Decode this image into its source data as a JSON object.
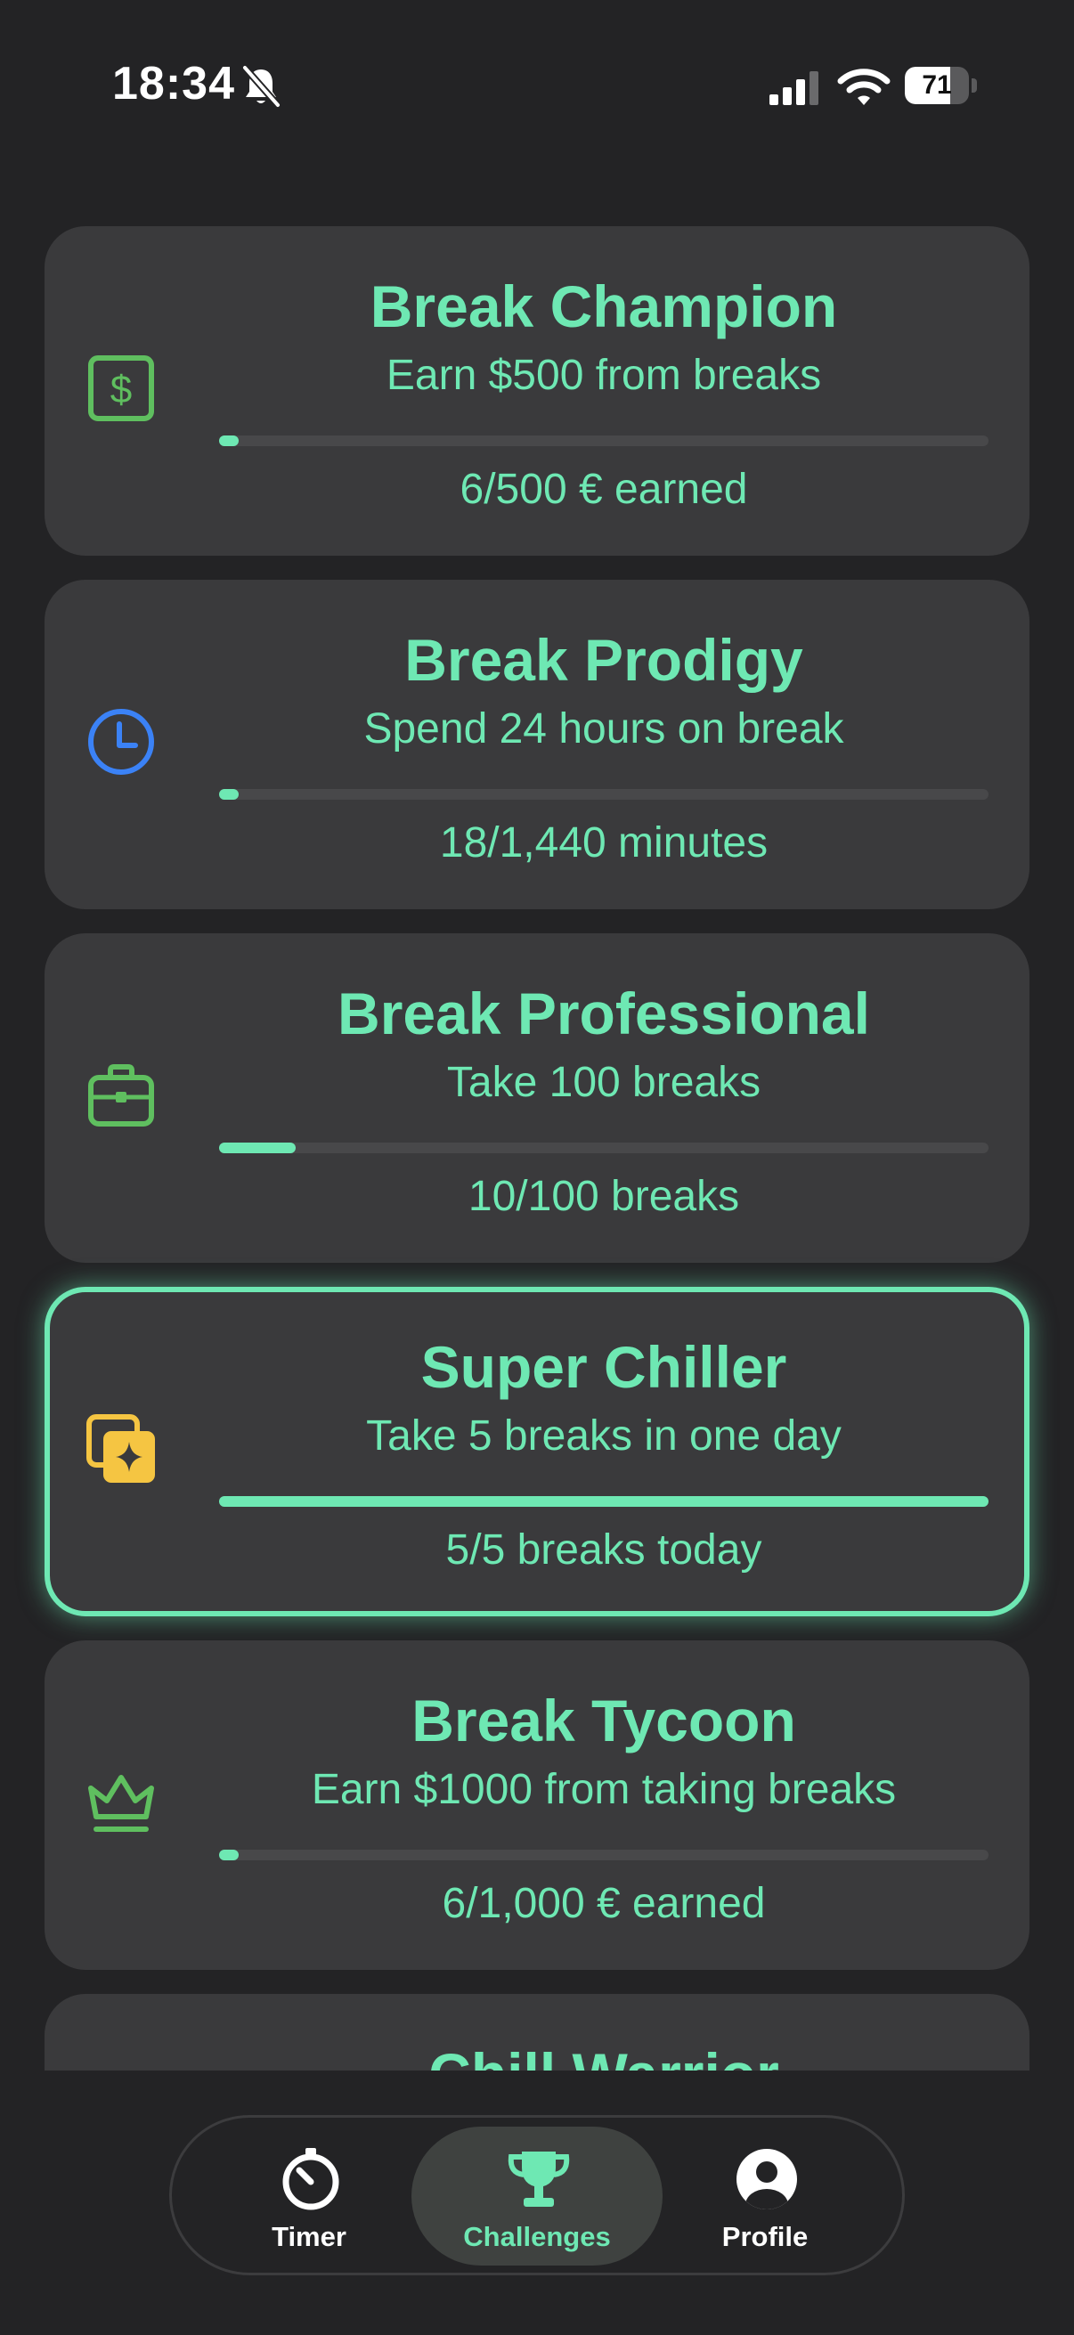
{
  "status_bar": {
    "time": "18:34",
    "battery_level": "71",
    "battery_fraction": 0.71
  },
  "colors": {
    "accent": "#6ee8b3",
    "card_bg": "#3a3a3c",
    "background": "#232325",
    "track": "#48484a",
    "dollar_icon": "#5fbf5f",
    "clock_icon": "#3b82f6",
    "briefcase_icon": "#5fbf5f",
    "sparkle_icon": "#f5c542",
    "crown_icon": "#5fbf5f"
  },
  "challenges": [
    {
      "icon": "dollar-icon",
      "title": "Break Champion",
      "description": "Earn $500 from breaks",
      "progress_text": "6/500 € earned",
      "progress_fraction": 0.012
    },
    {
      "icon": "clock-icon",
      "title": "Break Prodigy",
      "description": "Spend 24 hours on break",
      "progress_text": "18/1,440 minutes",
      "progress_fraction": 0.0125
    },
    {
      "icon": "briefcase-icon",
      "title": "Break Professional",
      "description": "Take 100 breaks",
      "progress_text": "10/100 breaks",
      "progress_fraction": 0.1
    },
    {
      "icon": "sparkle-icon",
      "title": "Super Chiller",
      "description": "Take 5 breaks in one day",
      "progress_text": "5/5 breaks today",
      "progress_fraction": 1.0,
      "completed": true
    },
    {
      "icon": "crown-icon",
      "title": "Break Tycoon",
      "description": "Earn $1000 from taking breaks",
      "progress_text": "6/1,000 € earned",
      "progress_fraction": 0.006
    },
    {
      "title": "Chill Warrior"
    }
  ],
  "tabs": [
    {
      "label": "Timer",
      "icon": "stopwatch-icon"
    },
    {
      "label": "Challenges",
      "icon": "trophy-icon",
      "active": true
    },
    {
      "label": "Profile",
      "icon": "person-icon"
    }
  ]
}
